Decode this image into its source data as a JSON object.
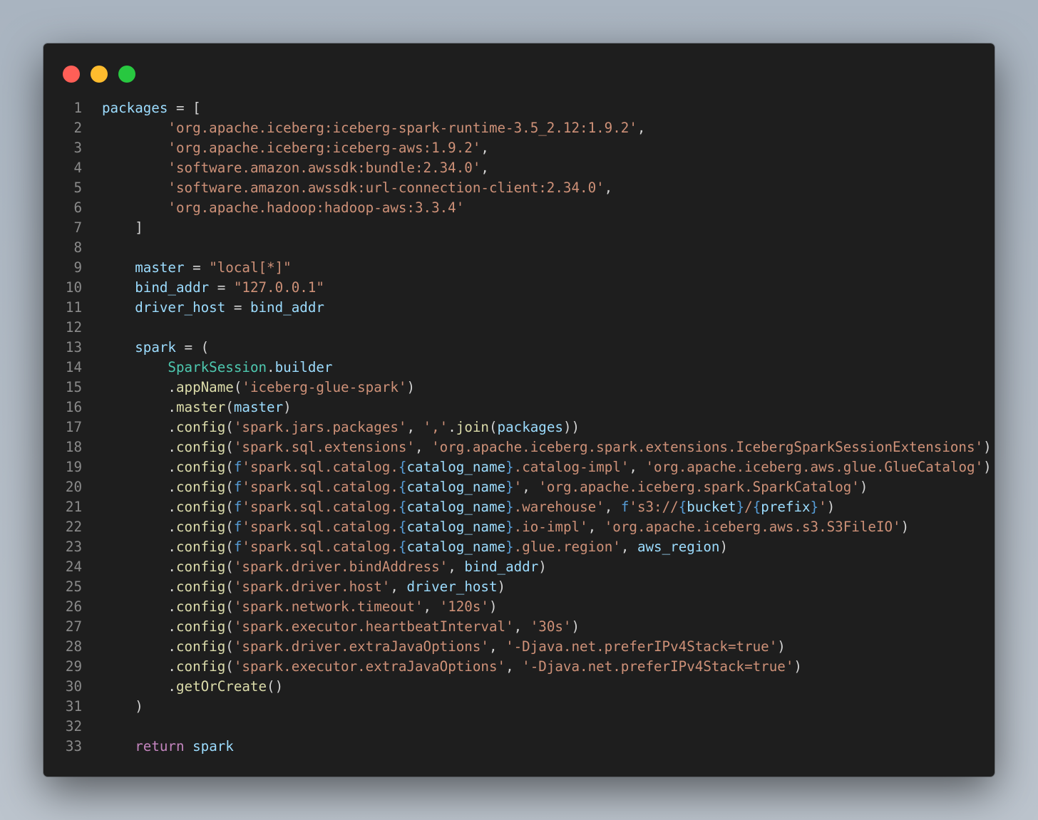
{
  "window": {
    "traffic_lights": [
      "close",
      "minimize",
      "maximize"
    ],
    "colors": {
      "close": "#ff5f57",
      "minimize": "#febc2e",
      "maximize": "#28c840",
      "background": "#1e1e1e"
    }
  },
  "code": {
    "language": "python",
    "lines": [
      {
        "n": "1",
        "tokens": [
          [
            "var",
            "packages"
          ],
          [
            "op",
            " = "
          ],
          [
            "pun",
            "["
          ]
        ]
      },
      {
        "n": "2",
        "tokens": [
          [
            "pun",
            "        "
          ],
          [
            "str",
            "'org.apache.iceberg:iceberg-spark-runtime-3.5_2.12:1.9.2'"
          ],
          [
            "pun",
            ","
          ]
        ]
      },
      {
        "n": "3",
        "tokens": [
          [
            "pun",
            "        "
          ],
          [
            "str",
            "'org.apache.iceberg:iceberg-aws:1.9.2'"
          ],
          [
            "pun",
            ","
          ]
        ]
      },
      {
        "n": "4",
        "tokens": [
          [
            "pun",
            "        "
          ],
          [
            "str",
            "'software.amazon.awssdk:bundle:2.34.0'"
          ],
          [
            "pun",
            ","
          ]
        ]
      },
      {
        "n": "5",
        "tokens": [
          [
            "pun",
            "        "
          ],
          [
            "str",
            "'software.amazon.awssdk:url-connection-client:2.34.0'"
          ],
          [
            "pun",
            ","
          ]
        ]
      },
      {
        "n": "6",
        "tokens": [
          [
            "pun",
            "        "
          ],
          [
            "str",
            "'org.apache.hadoop:hadoop-aws:3.3.4'"
          ]
        ]
      },
      {
        "n": "7",
        "tokens": [
          [
            "pun",
            "    ]"
          ]
        ]
      },
      {
        "n": "8",
        "tokens": []
      },
      {
        "n": "9",
        "tokens": [
          [
            "pun",
            "    "
          ],
          [
            "var",
            "master"
          ],
          [
            "op",
            " = "
          ],
          [
            "str",
            "\"local[*]\""
          ]
        ]
      },
      {
        "n": "10",
        "tokens": [
          [
            "pun",
            "    "
          ],
          [
            "var",
            "bind_addr"
          ],
          [
            "op",
            " = "
          ],
          [
            "str",
            "\"127.0.0.1\""
          ]
        ]
      },
      {
        "n": "11",
        "tokens": [
          [
            "pun",
            "    "
          ],
          [
            "var",
            "driver_host"
          ],
          [
            "op",
            " = "
          ],
          [
            "var",
            "bind_addr"
          ]
        ]
      },
      {
        "n": "12",
        "tokens": []
      },
      {
        "n": "13",
        "tokens": [
          [
            "pun",
            "    "
          ],
          [
            "var",
            "spark"
          ],
          [
            "op",
            " = "
          ],
          [
            "pun",
            "("
          ]
        ]
      },
      {
        "n": "14",
        "tokens": [
          [
            "pun",
            "        "
          ],
          [
            "cls",
            "SparkSession"
          ],
          [
            "pun",
            "."
          ],
          [
            "var",
            "builder"
          ]
        ]
      },
      {
        "n": "15",
        "tokens": [
          [
            "pun",
            "        ."
          ],
          [
            "fn",
            "appName"
          ],
          [
            "pun",
            "("
          ],
          [
            "str",
            "'iceberg-glue-spark'"
          ],
          [
            "pun",
            ")"
          ]
        ]
      },
      {
        "n": "16",
        "tokens": [
          [
            "pun",
            "        ."
          ],
          [
            "fn",
            "master"
          ],
          [
            "pun",
            "("
          ],
          [
            "var",
            "master"
          ],
          [
            "pun",
            ")"
          ]
        ]
      },
      {
        "n": "17",
        "tokens": [
          [
            "pun",
            "        ."
          ],
          [
            "fn",
            "config"
          ],
          [
            "pun",
            "("
          ],
          [
            "str",
            "'spark.jars.packages'"
          ],
          [
            "pun",
            ", "
          ],
          [
            "str",
            "','"
          ],
          [
            "pun",
            "."
          ],
          [
            "fn",
            "join"
          ],
          [
            "pun",
            "("
          ],
          [
            "var",
            "packages"
          ],
          [
            "pun",
            "))"
          ]
        ]
      },
      {
        "n": "18",
        "tokens": [
          [
            "pun",
            "        ."
          ],
          [
            "fn",
            "config"
          ],
          [
            "pun",
            "("
          ],
          [
            "str",
            "'spark.sql.extensions'"
          ],
          [
            "pun",
            ", "
          ],
          [
            "str",
            "'org.apache.iceberg.spark.extensions.IcebergSparkSessionExtensions'"
          ],
          [
            "pun",
            ")"
          ]
        ]
      },
      {
        "n": "19",
        "tokens": [
          [
            "pun",
            "        ."
          ],
          [
            "fn",
            "config"
          ],
          [
            "pun",
            "("
          ],
          [
            "fpre",
            "f"
          ],
          [
            "str",
            "'spark.sql.catalog."
          ],
          [
            "brace",
            "{"
          ],
          [
            "var",
            "catalog_name"
          ],
          [
            "brace",
            "}"
          ],
          [
            "str",
            ".catalog-impl'"
          ],
          [
            "pun",
            ", "
          ],
          [
            "str",
            "'org.apache.iceberg.aws.glue.GlueCatalog'"
          ],
          [
            "pun",
            ")"
          ]
        ]
      },
      {
        "n": "20",
        "tokens": [
          [
            "pun",
            "        ."
          ],
          [
            "fn",
            "config"
          ],
          [
            "pun",
            "("
          ],
          [
            "fpre",
            "f"
          ],
          [
            "str",
            "'spark.sql.catalog."
          ],
          [
            "brace",
            "{"
          ],
          [
            "var",
            "catalog_name"
          ],
          [
            "brace",
            "}"
          ],
          [
            "str",
            "'"
          ],
          [
            "pun",
            ", "
          ],
          [
            "str",
            "'org.apache.iceberg.spark.SparkCatalog'"
          ],
          [
            "pun",
            ")"
          ]
        ]
      },
      {
        "n": "21",
        "tokens": [
          [
            "pun",
            "        ."
          ],
          [
            "fn",
            "config"
          ],
          [
            "pun",
            "("
          ],
          [
            "fpre",
            "f"
          ],
          [
            "str",
            "'spark.sql.catalog."
          ],
          [
            "brace",
            "{"
          ],
          [
            "var",
            "catalog_name"
          ],
          [
            "brace",
            "}"
          ],
          [
            "str",
            ".warehouse'"
          ],
          [
            "pun",
            ", "
          ],
          [
            "fpre",
            "f"
          ],
          [
            "str",
            "'s3://"
          ],
          [
            "brace",
            "{"
          ],
          [
            "var",
            "bucket"
          ],
          [
            "brace",
            "}"
          ],
          [
            "str",
            "/"
          ],
          [
            "brace",
            "{"
          ],
          [
            "var",
            "prefix"
          ],
          [
            "brace",
            "}"
          ],
          [
            "str",
            "'"
          ],
          [
            "pun",
            ")"
          ]
        ]
      },
      {
        "n": "22",
        "tokens": [
          [
            "pun",
            "        ."
          ],
          [
            "fn",
            "config"
          ],
          [
            "pun",
            "("
          ],
          [
            "fpre",
            "f"
          ],
          [
            "str",
            "'spark.sql.catalog."
          ],
          [
            "brace",
            "{"
          ],
          [
            "var",
            "catalog_name"
          ],
          [
            "brace",
            "}"
          ],
          [
            "str",
            ".io-impl'"
          ],
          [
            "pun",
            ", "
          ],
          [
            "str",
            "'org.apache.iceberg.aws.s3.S3FileIO'"
          ],
          [
            "pun",
            ")"
          ]
        ]
      },
      {
        "n": "23",
        "tokens": [
          [
            "pun",
            "        ."
          ],
          [
            "fn",
            "config"
          ],
          [
            "pun",
            "("
          ],
          [
            "fpre",
            "f"
          ],
          [
            "str",
            "'spark.sql.catalog."
          ],
          [
            "brace",
            "{"
          ],
          [
            "var",
            "catalog_name"
          ],
          [
            "brace",
            "}"
          ],
          [
            "str",
            ".glue.region'"
          ],
          [
            "pun",
            ", "
          ],
          [
            "var",
            "aws_region"
          ],
          [
            "pun",
            ")"
          ]
        ]
      },
      {
        "n": "24",
        "tokens": [
          [
            "pun",
            "        ."
          ],
          [
            "fn",
            "config"
          ],
          [
            "pun",
            "("
          ],
          [
            "str",
            "'spark.driver.bindAddress'"
          ],
          [
            "pun",
            ", "
          ],
          [
            "var",
            "bind_addr"
          ],
          [
            "pun",
            ")"
          ]
        ]
      },
      {
        "n": "25",
        "tokens": [
          [
            "pun",
            "        ."
          ],
          [
            "fn",
            "config"
          ],
          [
            "pun",
            "("
          ],
          [
            "str",
            "'spark.driver.host'"
          ],
          [
            "pun",
            ", "
          ],
          [
            "var",
            "driver_host"
          ],
          [
            "pun",
            ")"
          ]
        ]
      },
      {
        "n": "26",
        "tokens": [
          [
            "pun",
            "        ."
          ],
          [
            "fn",
            "config"
          ],
          [
            "pun",
            "("
          ],
          [
            "str",
            "'spark.network.timeout'"
          ],
          [
            "pun",
            ", "
          ],
          [
            "str",
            "'120s'"
          ],
          [
            "pun",
            ")"
          ]
        ]
      },
      {
        "n": "27",
        "tokens": [
          [
            "pun",
            "        ."
          ],
          [
            "fn",
            "config"
          ],
          [
            "pun",
            "("
          ],
          [
            "str",
            "'spark.executor.heartbeatInterval'"
          ],
          [
            "pun",
            ", "
          ],
          [
            "str",
            "'30s'"
          ],
          [
            "pun",
            ")"
          ]
        ]
      },
      {
        "n": "28",
        "tokens": [
          [
            "pun",
            "        ."
          ],
          [
            "fn",
            "config"
          ],
          [
            "pun",
            "("
          ],
          [
            "str",
            "'spark.driver.extraJavaOptions'"
          ],
          [
            "pun",
            ", "
          ],
          [
            "str",
            "'-Djava.net.preferIPv4Stack=true'"
          ],
          [
            "pun",
            ")"
          ]
        ]
      },
      {
        "n": "29",
        "tokens": [
          [
            "pun",
            "        ."
          ],
          [
            "fn",
            "config"
          ],
          [
            "pun",
            "("
          ],
          [
            "str",
            "'spark.executor.extraJavaOptions'"
          ],
          [
            "pun",
            ", "
          ],
          [
            "str",
            "'-Djava.net.preferIPv4Stack=true'"
          ],
          [
            "pun",
            ")"
          ]
        ]
      },
      {
        "n": "30",
        "tokens": [
          [
            "pun",
            "        ."
          ],
          [
            "fn",
            "getOrCreate"
          ],
          [
            "pun",
            "()"
          ]
        ]
      },
      {
        "n": "31",
        "tokens": [
          [
            "pun",
            "    )"
          ]
        ]
      },
      {
        "n": "32",
        "tokens": []
      },
      {
        "n": "33",
        "tokens": [
          [
            "pun",
            "    "
          ],
          [
            "kw",
            "return"
          ],
          [
            "pun",
            " "
          ],
          [
            "var",
            "spark"
          ]
        ]
      }
    ]
  }
}
